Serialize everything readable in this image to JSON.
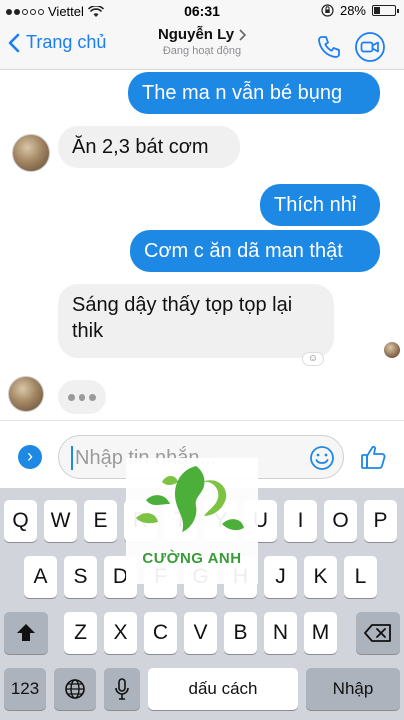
{
  "status_bar": {
    "carrier": "Viettel",
    "time": "06:31",
    "battery_text": "28%",
    "battery_level": 0.28
  },
  "header": {
    "back_label": "Trang chủ",
    "contact_name": "Nguyễn Ly",
    "contact_status": "Đang hoạt động"
  },
  "messages": [
    {
      "side": "out",
      "text": "The ma n vẫn bé bụng"
    },
    {
      "side": "in",
      "text": "Ăn 2,3 bát cơm"
    },
    {
      "side": "out",
      "text": "Thích nhỉ"
    },
    {
      "side": "out",
      "text": "Cơm c ăn dã man thật"
    },
    {
      "side": "in",
      "text_line1": "Sáng dậy thấy tọp tọp lại",
      "text_line2": "thik"
    }
  ],
  "composer": {
    "placeholder": "Nhập tin nhắn..."
  },
  "keyboard": {
    "row1": [
      "Q",
      "W",
      "E",
      "R",
      "T",
      "Y",
      "U",
      "I",
      "O",
      "P"
    ],
    "row2": [
      "A",
      "S",
      "D",
      "F",
      "G",
      "H",
      "J",
      "K",
      "L"
    ],
    "row3": [
      "Z",
      "X",
      "C",
      "V",
      "B",
      "N",
      "M"
    ],
    "numbers_key": "123",
    "space_key": "dấu cách",
    "return_key": "Nhập"
  },
  "watermark": {
    "text": "CƯỜNG ANH"
  },
  "colors": {
    "accent": "#1e88e5",
    "incoming_bubble": "#f0f0f0",
    "keyboard_bg": "#d1d4da",
    "watermark_green": "#3a9b3a"
  },
  "icons": [
    "signal-dots-icon",
    "wifi-icon",
    "lock-rotation-icon",
    "battery-icon",
    "back-chevron-icon",
    "chevron-right-icon",
    "phone-icon",
    "video-camera-icon",
    "expand-arrow-icon",
    "emoji-icon",
    "thumbs-up-icon",
    "shift-icon",
    "backspace-icon",
    "globe-icon",
    "microphone-icon"
  ]
}
